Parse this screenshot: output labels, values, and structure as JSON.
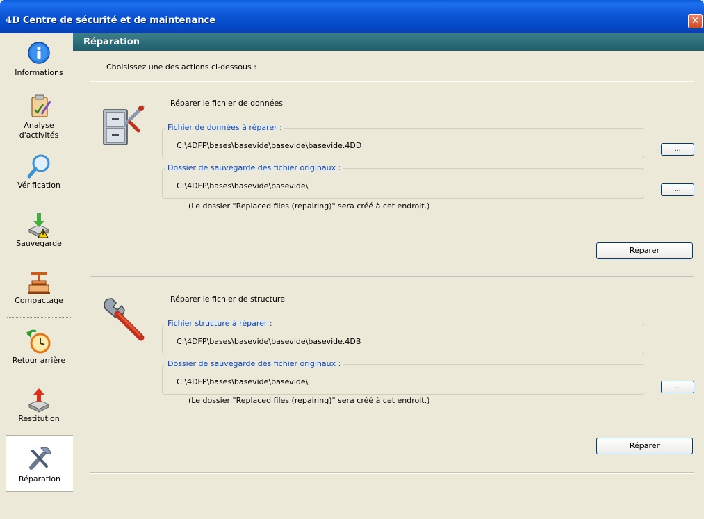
{
  "window": {
    "title": "Centre de sécurité et de maintenance",
    "logo": "4D",
    "close_glyph": "✕"
  },
  "sidebar": {
    "items": [
      {
        "label": "Informations",
        "icon": "info-icon"
      },
      {
        "label": "Analyse\nd'activités",
        "icon": "clipboard-icon"
      },
      {
        "label": "Vérification",
        "icon": "magnifier-icon"
      },
      {
        "label": "Sauvegarde",
        "icon": "backup-disk-icon"
      },
      {
        "label": "Compactage",
        "icon": "compact-press-icon"
      },
      {
        "label": "Retour arrière",
        "icon": "clock-rollback-icon"
      },
      {
        "label": "Restitution",
        "icon": "restore-disk-icon"
      },
      {
        "label": "Réparation",
        "icon": "wrench-icon",
        "active": true
      }
    ]
  },
  "main": {
    "header": "Réparation",
    "instruction": "Choisissez une des actions ci-dessous :",
    "data_section": {
      "title": "Réparer le fichier de données",
      "file_legend": "Fichier de données à réparer :",
      "file_path": "C:\\4DFP\\bases\\basevide\\basevide\\basevide.4DD",
      "backup_legend": "Dossier de sauvegarde des fichier originaux :",
      "backup_path": "C:\\4DFP\\bases\\basevide\\basevide\\",
      "note": "(Le dossier \"Replaced files (repairing)\" sera créé à cet endroit.)",
      "browse_label": "...",
      "repair_label": "Réparer"
    },
    "structure_section": {
      "title": "Réparer le fichier de structure",
      "file_legend": "Fichier structure à réparer :",
      "file_path": "C:\\4DFP\\bases\\basevide\\basevide\\basevide.4DB",
      "backup_legend": "Dossier de sauvegarde des fichier originaux :",
      "backup_path": "C:\\4DFP\\bases\\basevide\\basevide\\",
      "note": "(Le dossier \"Replaced files (repairing)\" sera créé à cet endroit.)",
      "browse_label": "...",
      "repair_label": "Réparer"
    }
  },
  "colors": {
    "titlebar": "#0c56d6",
    "section_header": "#2a6b78",
    "legend_text": "#0046d5",
    "close_button": "#d24a24"
  }
}
